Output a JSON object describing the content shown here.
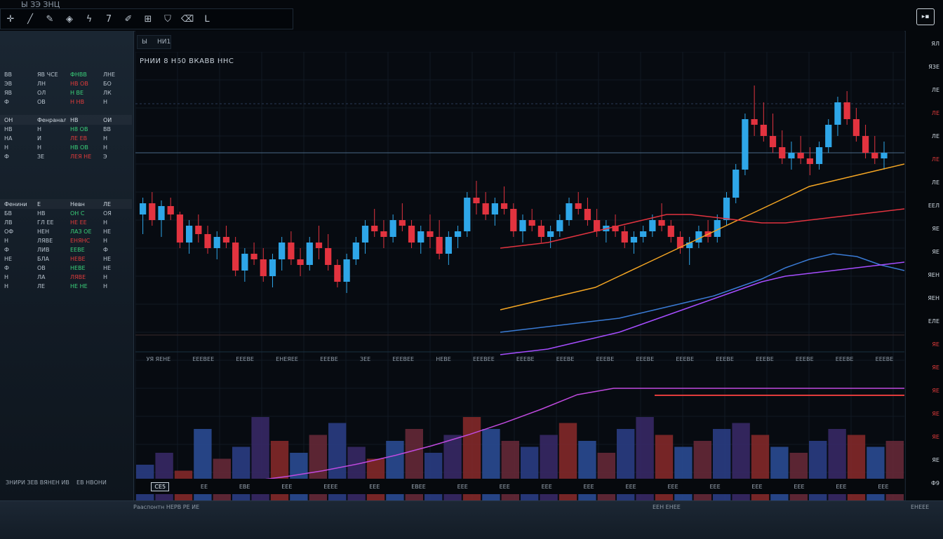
{
  "app": {
    "title": "Ы ЗЭ ЗНЦ"
  },
  "toolbar": {
    "icons": [
      "crosshair-icon",
      "line-icon",
      "pen-icon",
      "shape-icon",
      "fib-icon",
      "text-icon",
      "brush-icon",
      "ruler-icon",
      "shield-icon",
      "eraser-icon",
      "layout-icon"
    ]
  },
  "window": {
    "btn": "▸▪"
  },
  "chart": {
    "tabs": [
      "Ы",
      "НИ1"
    ],
    "title": "РНИИ  8 Н60  ВКАВВ ННС"
  },
  "leftpanel": {
    "section1": {
      "rows": [
        [
          "ВВ",
          "ЯВ ЧСЕ",
          "ФНВВ",
          "ЛНЕ"
        ],
        [
          "ЭВ",
          "ЛН",
          "НВ ОВ",
          "БО"
        ],
        [
          "ЯВ",
          "ОЛ",
          "Н ВЕ",
          "ЛК"
        ],
        [
          "Ф",
          "ОВ",
          "Н НВ",
          "Н"
        ]
      ]
    },
    "section2": {
      "head": [
        "ОН",
        "Фенраналли",
        "НВ",
        "ОИ"
      ],
      "rows": [
        [
          "НВ",
          "Н",
          "Н8 ОВ",
          "ВВ"
        ],
        [
          "НА",
          "И",
          "ЛЕ ЕВ",
          "Н"
        ],
        [
          "Н",
          "Н",
          "НВ ОВ",
          "Н"
        ],
        [
          "Ф",
          "ЗЕ",
          "ЛЕЯ НЕ",
          "Э"
        ]
      ]
    },
    "section3": {
      "head": [
        "Фенини",
        "Е",
        "Невн",
        "ЛЕ"
      ],
      "rows": [
        [
          "БВ",
          "НВ",
          "ОН С",
          "ОЯ"
        ],
        [
          "ЛВ",
          "ГЛ ЕЕ",
          "НЕ ЕЕ",
          "Н"
        ],
        [
          "ОФ",
          "НЕН",
          "ЛАЗ ОЕ",
          "НЕ"
        ],
        [
          "Н",
          "ЛЯВЕ",
          "ЕНЯНС",
          "Н"
        ],
        [
          "Ф",
          "ЛИВ",
          "ЕЕВЕ",
          "Ф"
        ],
        [
          "НЕ",
          "БЛА",
          "НЕВЕ",
          "НЕ"
        ],
        [
          "Ф",
          "ОВ",
          "НЕВЕ",
          "НЕ"
        ],
        [
          "Н",
          "ЛА",
          "ЛЯВЕ",
          "Н"
        ],
        [
          "Н",
          "ЛЕ",
          "НЕ НЕ",
          "Н"
        ]
      ]
    },
    "footer_left": "ЗНИРИ ЗЕВ ВЯНЕН ИВ",
    "footer_right": "ЕВ НВОНИ",
    "footer_bottom_label": "Рааспонтн НЕРВ РЕ ИЕ"
  },
  "right_axis": {
    "labels": [
      {
        "t": "ЯЛ",
        "red": false
      },
      {
        "t": "ЯЗЕ",
        "red": false
      },
      {
        "t": "ЛЕ",
        "red": false
      },
      {
        "t": "ЛЕ",
        "red": true
      },
      {
        "t": "ЛЕ",
        "red": false
      },
      {
        "t": "ЛЕ",
        "red": true
      },
      {
        "t": "ЛЕ",
        "red": false
      },
      {
        "t": "ЕЕЛ",
        "red": false
      },
      {
        "t": "ЯЕ",
        "red": false
      },
      {
        "t": "ЯЕ",
        "red": false
      },
      {
        "t": "ЯЕН",
        "red": false
      },
      {
        "t": "ЯЕН",
        "red": false
      },
      {
        "t": "ЕЛЕ",
        "red": false
      },
      {
        "t": "ЯЕ",
        "red": true
      },
      {
        "t": "ЯЕ",
        "red": true
      },
      {
        "t": "ЯЕ",
        "red": true
      },
      {
        "t": "ЯЕ",
        "red": true
      },
      {
        "t": "ЯЕ",
        "red": true
      },
      {
        "t": "ЯЕ",
        "red": false
      },
      {
        "t": "Ф9",
        "red": false
      }
    ]
  },
  "mid_axis": [
    "УЯ ЯЕНЕ",
    "ЕЕЕВЕЕ",
    "ЕЕЕВЕ",
    "ЕНЕЯЕЕ",
    "ЕЕЕВЕ",
    "ЗЕЕ",
    "ЕЕЕВЕЕ",
    "НЕВЕ",
    "ЕЕЕВЕЕ",
    "ЕЕЕВЕ",
    "ЕЕЕВЕ",
    "ЕЕЕВЕ",
    "ЕЕЕВЕ",
    "ЕЕЕВЕ",
    "ЕЕЕВЕ",
    "ЕЕЕВЕ",
    "ЕЕЕВЕ",
    "ЕЕЕВЕ",
    "ЕЕЕВЕ"
  ],
  "bottom_axis": [
    "СЕ5",
    "ЕЕ",
    "ЕВЕ",
    "ЕЕЕ",
    "ЕЕЕЕ",
    "ЕЕЕ",
    "ЕВЕЕ",
    "ЕЕЕ",
    "ЕЕЕ",
    "ЕЕЕ",
    "ЕЕЕ",
    "ЕЕЕ",
    "ЕЕЕ",
    "ЕЕЕ",
    "ЕЕЕ",
    "ЕЕЕ",
    "ЕЕЕ",
    "ЕЕЕ"
  ],
  "status": {
    "left": "Рааспонтн НЕРВ РЕ ИЕ",
    "mid": "ЕЕН ЕНЕЕ",
    "right": "ЕНЕЕЕ"
  },
  "colors": {
    "up": "#2ea6e8",
    "down": "#e2333f",
    "bg": "#070b11"
  },
  "chart_data": {
    "type": "line",
    "series": [
      {
        "kind": "candles",
        "values": [
          [
            52,
            58,
            45,
            56
          ],
          [
            56,
            60,
            48,
            50
          ],
          [
            50,
            57,
            44,
            55
          ],
          [
            55,
            58,
            50,
            52
          ],
          [
            52,
            53,
            40,
            42
          ],
          [
            42,
            50,
            38,
            48
          ],
          [
            48,
            52,
            42,
            45
          ],
          [
            45,
            48,
            38,
            40
          ],
          [
            40,
            46,
            36,
            44
          ],
          [
            44,
            48,
            40,
            42
          ],
          [
            42,
            44,
            30,
            32
          ],
          [
            32,
            40,
            28,
            38
          ],
          [
            38,
            42,
            34,
            36
          ],
          [
            36,
            40,
            28,
            30
          ],
          [
            30,
            38,
            26,
            36
          ],
          [
            36,
            44,
            32,
            42
          ],
          [
            42,
            46,
            34,
            36
          ],
          [
            36,
            40,
            30,
            34
          ],
          [
            34,
            44,
            32,
            42
          ],
          [
            42,
            48,
            36,
            40
          ],
          [
            40,
            45,
            32,
            34
          ],
          [
            34,
            36,
            26,
            28
          ],
          [
            28,
            38,
            24,
            36
          ],
          [
            36,
            44,
            34,
            42
          ],
          [
            42,
            50,
            38,
            48
          ],
          [
            48,
            54,
            44,
            46
          ],
          [
            46,
            50,
            40,
            44
          ],
          [
            44,
            52,
            42,
            50
          ],
          [
            50,
            56,
            46,
            48
          ],
          [
            48,
            50,
            40,
            42
          ],
          [
            42,
            48,
            38,
            46
          ],
          [
            46,
            52,
            40,
            44
          ],
          [
            44,
            50,
            36,
            38
          ],
          [
            38,
            46,
            34,
            44
          ],
          [
            44,
            48,
            40,
            46
          ],
          [
            46,
            60,
            44,
            58
          ],
          [
            58,
            64,
            52,
            56
          ],
          [
            56,
            60,
            50,
            52
          ],
          [
            52,
            58,
            48,
            56
          ],
          [
            56,
            62,
            52,
            54
          ],
          [
            54,
            56,
            44,
            46
          ],
          [
            46,
            52,
            42,
            50
          ],
          [
            50,
            54,
            46,
            48
          ],
          [
            48,
            50,
            42,
            44
          ],
          [
            44,
            48,
            40,
            46
          ],
          [
            46,
            52,
            44,
            50
          ],
          [
            50,
            58,
            48,
            56
          ],
          [
            56,
            60,
            52,
            54
          ],
          [
            54,
            58,
            48,
            50
          ],
          [
            50,
            54,
            44,
            46
          ],
          [
            46,
            50,
            42,
            48
          ],
          [
            48,
            52,
            44,
            46
          ],
          [
            46,
            48,
            40,
            42
          ],
          [
            42,
            46,
            38,
            44
          ],
          [
            44,
            48,
            42,
            46
          ],
          [
            46,
            52,
            44,
            50
          ],
          [
            50,
            56,
            46,
            48
          ],
          [
            48,
            50,
            42,
            44
          ],
          [
            44,
            46,
            38,
            40
          ],
          [
            40,
            44,
            34,
            42
          ],
          [
            42,
            48,
            40,
            46
          ],
          [
            46,
            50,
            42,
            44
          ],
          [
            44,
            52,
            42,
            50
          ],
          [
            50,
            60,
            48,
            58
          ],
          [
            58,
            70,
            56,
            68
          ],
          [
            68,
            88,
            66,
            86
          ],
          [
            86,
            98,
            80,
            84
          ],
          [
            84,
            92,
            78,
            80
          ],
          [
            80,
            88,
            74,
            76
          ],
          [
            76,
            82,
            70,
            72
          ],
          [
            72,
            78,
            68,
            74
          ],
          [
            74,
            80,
            70,
            72
          ],
          [
            72,
            76,
            66,
            70
          ],
          [
            70,
            78,
            68,
            76
          ],
          [
            76,
            86,
            74,
            84
          ],
          [
            84,
            94,
            80,
            92
          ],
          [
            92,
            96,
            84,
            86
          ],
          [
            86,
            90,
            78,
            80
          ],
          [
            80,
            84,
            72,
            74
          ],
          [
            74,
            80,
            70,
            72
          ],
          [
            72,
            78,
            68,
            74
          ]
        ]
      },
      {
        "kind": "line",
        "color": "#f5a623",
        "values": [
          18,
          20,
          22,
          24,
          26,
          30,
          34,
          38,
          42,
          46,
          50,
          54,
          58,
          62,
          64,
          66,
          68,
          70
        ]
      },
      {
        "kind": "line",
        "color": "#e2333f",
        "values": [
          40,
          41,
          42,
          44,
          46,
          48,
          50,
          52,
          52,
          51,
          50,
          49,
          49,
          50,
          51,
          52,
          53,
          54
        ]
      },
      {
        "kind": "line",
        "color": "#3a7bd5",
        "values": [
          10,
          11,
          12,
          13,
          14,
          15,
          17,
          19,
          21,
          23,
          26,
          29,
          33,
          36,
          38,
          37,
          34,
          32
        ]
      },
      {
        "kind": "line",
        "color": "#a64dff",
        "values": [
          2,
          3,
          4,
          6,
          8,
          10,
          13,
          16,
          19,
          22,
          25,
          28,
          30,
          31,
          32,
          33,
          34,
          35
        ]
      }
    ],
    "volume": {
      "values": [
        30,
        40,
        25,
        60,
        35,
        45,
        70,
        50,
        40,
        55,
        65,
        45,
        35,
        50,
        60,
        40,
        55,
        70,
        60,
        50,
        45,
        55,
        65,
        50,
        40,
        60,
        70,
        55,
        45,
        50,
        60,
        65,
        55,
        45,
        40,
        50,
        60,
        55,
        45,
        50
      ],
      "colors_pattern": [
        "#2b3f8a",
        "#3a2a6a",
        "#8a2a2a",
        "#2b4f9a",
        "#6a2a3a"
      ]
    },
    "ylim": [
      0,
      100
    ],
    "grid": true,
    "legend": "none"
  }
}
